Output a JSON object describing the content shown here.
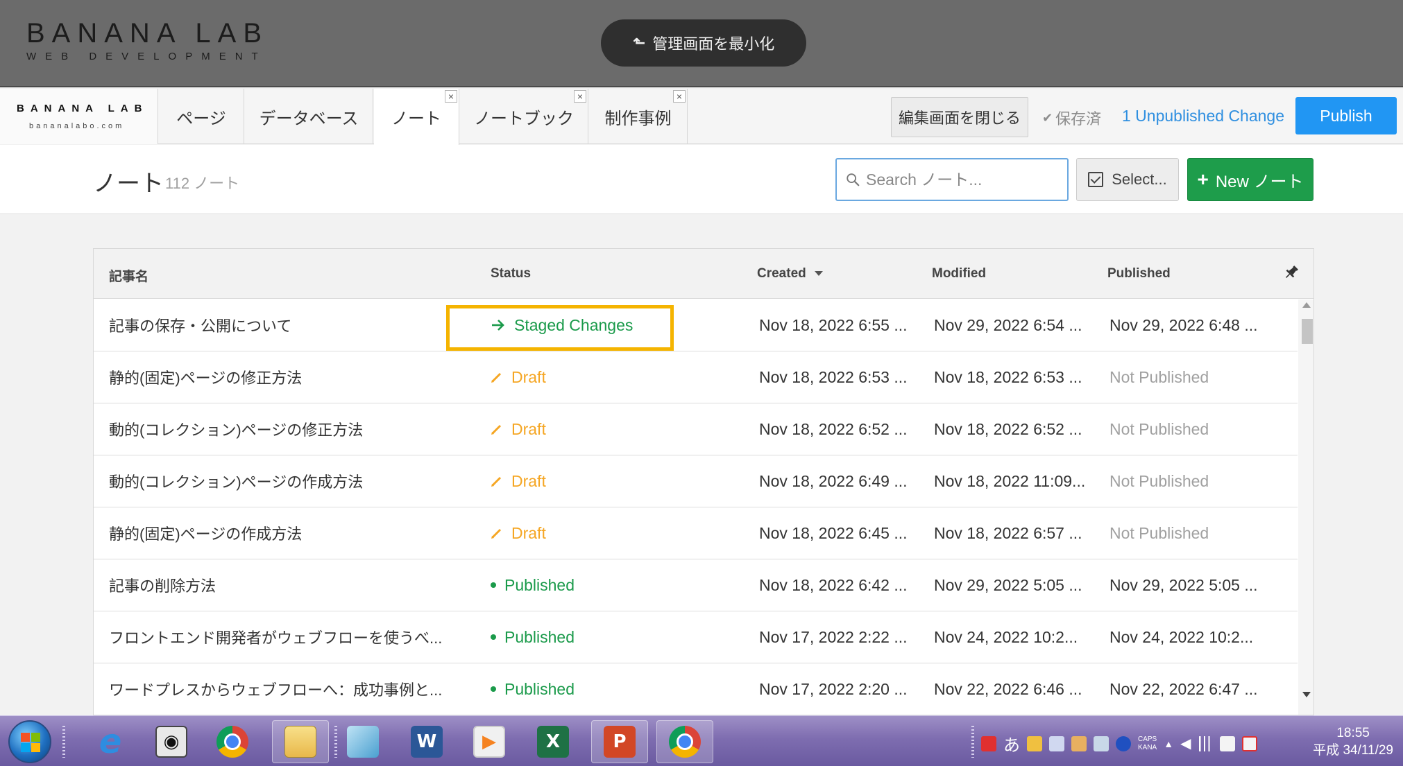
{
  "site_header": {
    "logo_main": "BANANA LAB",
    "logo_sub": "WEB DEVELOPMENT",
    "minimize_label": "管理画面を最小化"
  },
  "designer_bar": {
    "brand_main": "BANANA LAB",
    "brand_sub": "bananalabo.com",
    "tabs": [
      {
        "label": "ページ",
        "closable": false
      },
      {
        "label": "データベース",
        "closable": false
      },
      {
        "label": "ノート",
        "closable": true,
        "active": true
      },
      {
        "label": "ノートブック",
        "closable": true
      },
      {
        "label": "制作事例",
        "closable": true
      }
    ],
    "close_editor_label": "編集画面を閉じる",
    "saved_label": "保存済",
    "unpublished_label": "1 Unpublished Change",
    "publish_label": "Publish",
    "tab_close_glyph": "×"
  },
  "content": {
    "title": "ノート",
    "count": "112 ノート",
    "search_placeholder": "Search ノート...",
    "select_label": "Select...",
    "new_label": "New ノート"
  },
  "table": {
    "columns": {
      "name": "記事名",
      "status": "Status",
      "created": "Created",
      "modified": "Modified",
      "published": "Published"
    },
    "rows": [
      {
        "name": "記事の保存・公開について",
        "status": "Staged Changes",
        "created": "Nov 18, 2022 6:55 ...",
        "modified": "Nov 29, 2022 6:54 ...",
        "published": "Nov 29, 2022 6:48 ..."
      },
      {
        "name": "静的(固定)ページの修正方法",
        "status": "Draft",
        "created": "Nov 18, 2022 6:53 ...",
        "modified": "Nov 18, 2022 6:53 ...",
        "published": "Not Published"
      },
      {
        "name": "動的(コレクション)ページの修正方法",
        "status": "Draft",
        "created": "Nov 18, 2022 6:52 ...",
        "modified": "Nov 18, 2022 6:52 ...",
        "published": "Not Published"
      },
      {
        "name": "動的(コレクション)ページの作成方法",
        "status": "Draft",
        "created": "Nov 18, 2022 6:49 ...",
        "modified": "Nov 18, 2022 11:09...",
        "published": "Not Published"
      },
      {
        "name": "静的(固定)ページの作成方法",
        "status": "Draft",
        "created": "Nov 18, 2022 6:45 ...",
        "modified": "Nov 18, 2022 6:57 ...",
        "published": "Not Published"
      },
      {
        "name": "記事の削除方法",
        "status": "Published",
        "created": "Nov 18, 2022 6:42 ...",
        "modified": "Nov 29, 2022 5:05 ...",
        "published": "Nov 29, 2022 5:05 ..."
      },
      {
        "name": "フロントエンド開発者がウェブフローを使うべ...",
        "status": "Published",
        "created": "Nov 17, 2022 2:22 ...",
        "modified": "Nov 24, 2022 10:2...",
        "published": "Nov 24, 2022 10:2..."
      },
      {
        "name": "ワードプレスからウェブフローへ：成功事例と...",
        "status": "Published",
        "created": "Nov 17, 2022 2:20 ...",
        "modified": "Nov 22, 2022 6:46 ...",
        "published": "Nov 22, 2022 6:47 ..."
      }
    ]
  },
  "taskbar": {
    "ime_mode": "あ",
    "caps": "CAPS",
    "kana": "KANA",
    "time": "18:55",
    "date": "平成 34/11/29"
  },
  "colors": {
    "accent_blue": "#2196f3",
    "new_green": "#1e9d4b",
    "staged_green": "#1a9a4a",
    "draft_orange": "#f5a623",
    "highlight_yellow": "#f5b400"
  }
}
